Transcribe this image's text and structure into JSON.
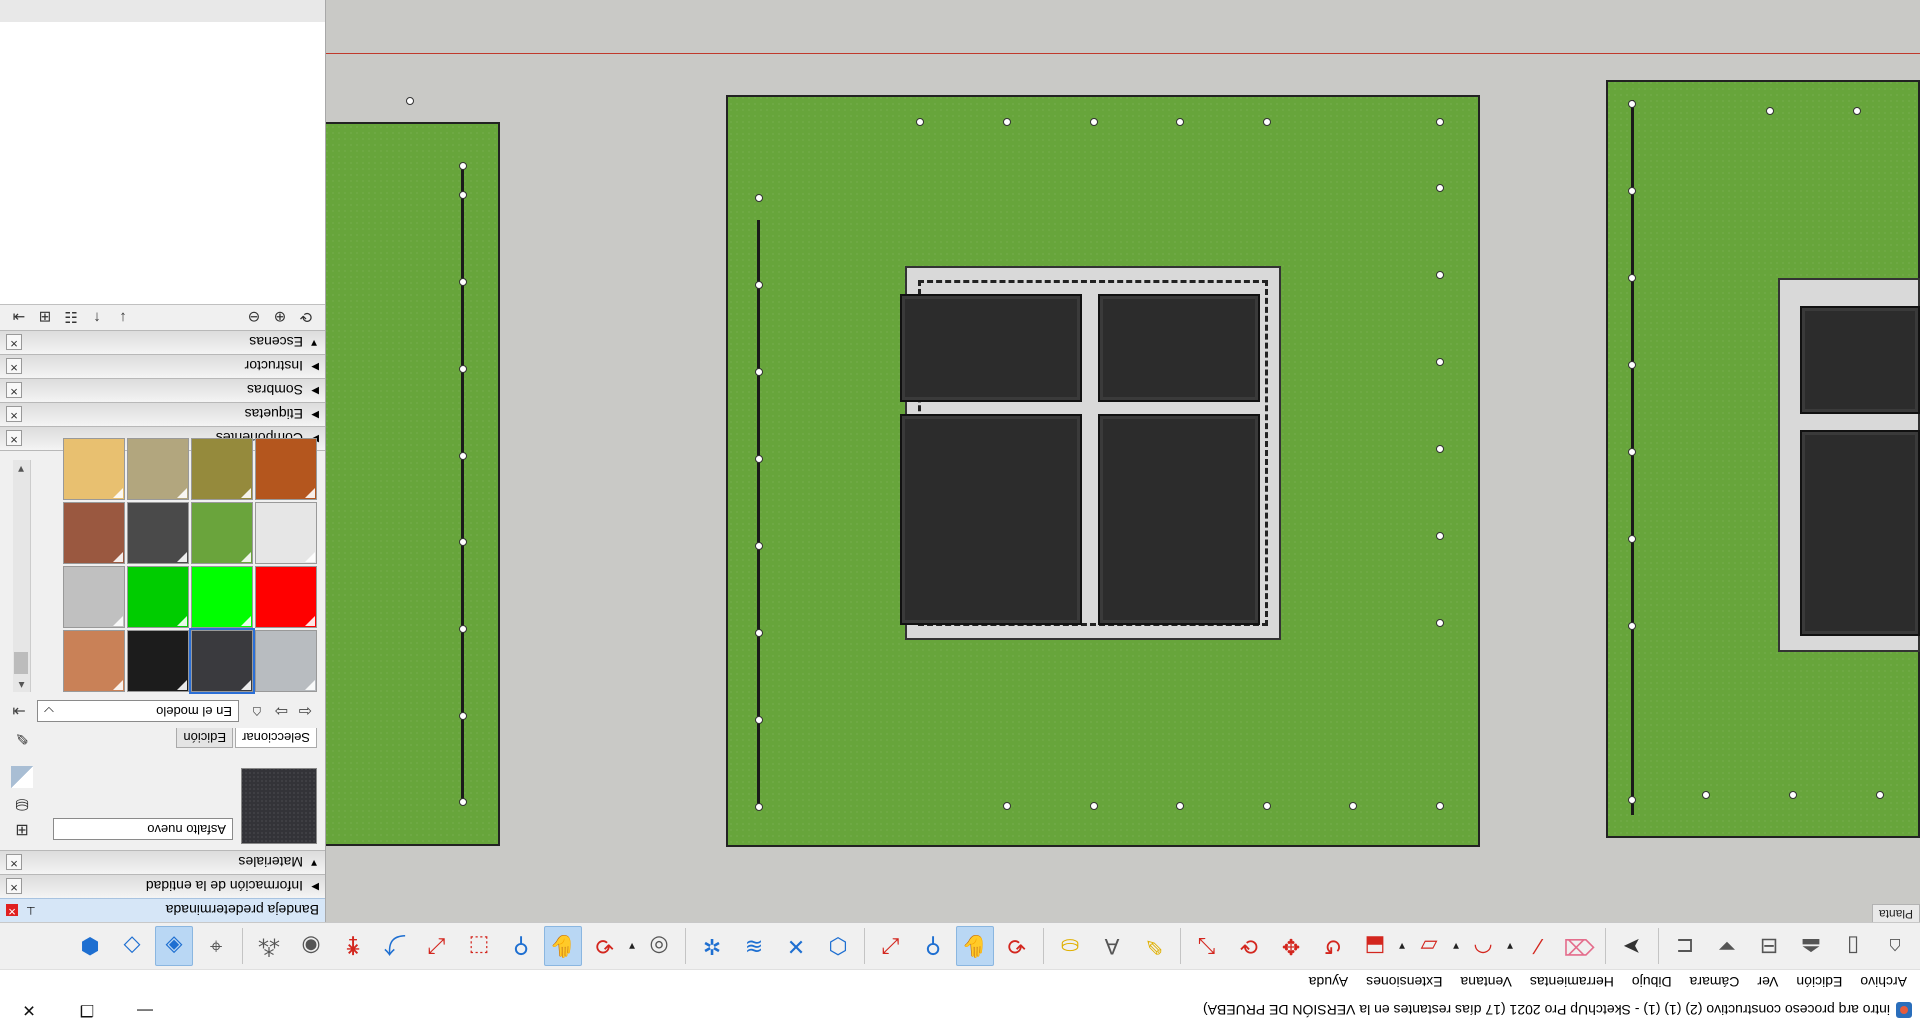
{
  "window": {
    "title": "intro arq proceso constructivo (2) (1) (1) - SketchUp Pro 2021 (17 días restantes en la VERSIÓN DE PRUEBA)",
    "minimize": "—",
    "maximize": "❐",
    "close": "✕"
  },
  "menus": [
    "Archivo",
    "Edición",
    "Ver",
    "Cámara",
    "Dibujo",
    "Herramientas",
    "Ventana",
    "Extensiones",
    "Ayuda"
  ],
  "toolbar": {
    "icons": [
      "section-plane-icon",
      "front-view-icon",
      "top-view-icon",
      "iso-view-icon",
      "right-view-icon",
      "back-view-icon",
      "select-icon",
      "eraser-icon",
      "line-icon",
      "arc-icon",
      "rectangle-icon",
      "push-pull-icon",
      "offset-icon",
      "move-icon",
      "rotate-icon",
      "scale-icon",
      "tape-icon",
      "text-icon",
      "paint-icon",
      "orbit-icon",
      "pan-icon",
      "zoom-icon",
      "zoom-extents-icon",
      "components-icon",
      "materials-icon",
      "styles-icon",
      "layers-icon",
      "sandbox-icon",
      "orbit2-icon",
      "pan2-icon",
      "zoom2-icon",
      "zoom-window-icon",
      "previous-icon",
      "position-camera-icon",
      "look-around-icon",
      "walk-icon",
      "axes-icon",
      "xray-icon",
      "back-edges-icon",
      "wireframe-icon"
    ]
  },
  "canvas": {
    "scene_label": "Planta"
  },
  "tray": {
    "title": "Bandeja predeterminada",
    "sections": {
      "entity_info": "Información de la entidad",
      "materials": "Materiales",
      "components": "Componentes",
      "tags": "Etiquetas",
      "shadows": "Sombras",
      "instructor": "Instructor",
      "scenes": "Escenas"
    },
    "materials": {
      "current_name": "Asfalto nuevo",
      "tab_select": "Seleccionar",
      "tab_edit": "Edición",
      "collection": "En el modelo",
      "swatch_colors": [
        "#b8bcc0",
        "#3a3a3e",
        "#1c1c1c",
        "#c98157",
        "#ff0000",
        "#00ff00",
        "#00cc00",
        "#c0c0c0",
        "#e6e6e6",
        "#6aa43c",
        "#4a4a4a",
        "#9a5840",
        "#b4561e",
        "#958a3c",
        "#b2a67e",
        "#e8c070"
      ]
    }
  }
}
